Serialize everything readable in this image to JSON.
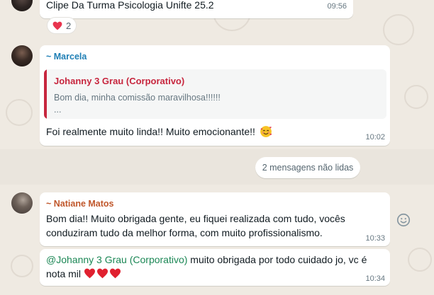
{
  "top_message": {
    "text": "Clipe Da Turma Psicologia Unifte 25.2",
    "time": "09:56",
    "reaction_count": "2"
  },
  "marcela_message": {
    "sender": "~ Marcela",
    "sender_color": "#1f7fb5",
    "quote_author": "Johanny 3 Grau (Corporativo)",
    "quote_text": "Bom dia, minha comissão maravilhosa!!!!!!",
    "quote_ellipsis": "...",
    "text": "Foi realmente muito linda!! Muito emocionante!!",
    "emoji": "smiling-face-with-hearts",
    "time": "10:02"
  },
  "unread_divider": {
    "label": "2 mensagens não lidas"
  },
  "natiane_message": {
    "sender": "~ Natiane Matos",
    "sender_color": "#c0572b",
    "line1": "Bom dia!! Muito obrigada gente, eu fiquei realizada com tudo, vocês",
    "line2": "conduziram tudo da melhor forma, com muito profissionalismo.",
    "time": "10:33"
  },
  "natiane_reply": {
    "mention": "@Johanny 3 Grau (Corporativo)",
    "line1_rest": " muito obrigada por todo cuidado jo, vc é",
    "line2": "nota mil",
    "emoji": "red-heart x3",
    "time": "10:34"
  },
  "colors": {
    "chat_background": "#efeae2",
    "bubble": "#ffffff",
    "quote_accent": "#c7263e",
    "mention": "#1b8755",
    "timestamp": "#667781"
  }
}
